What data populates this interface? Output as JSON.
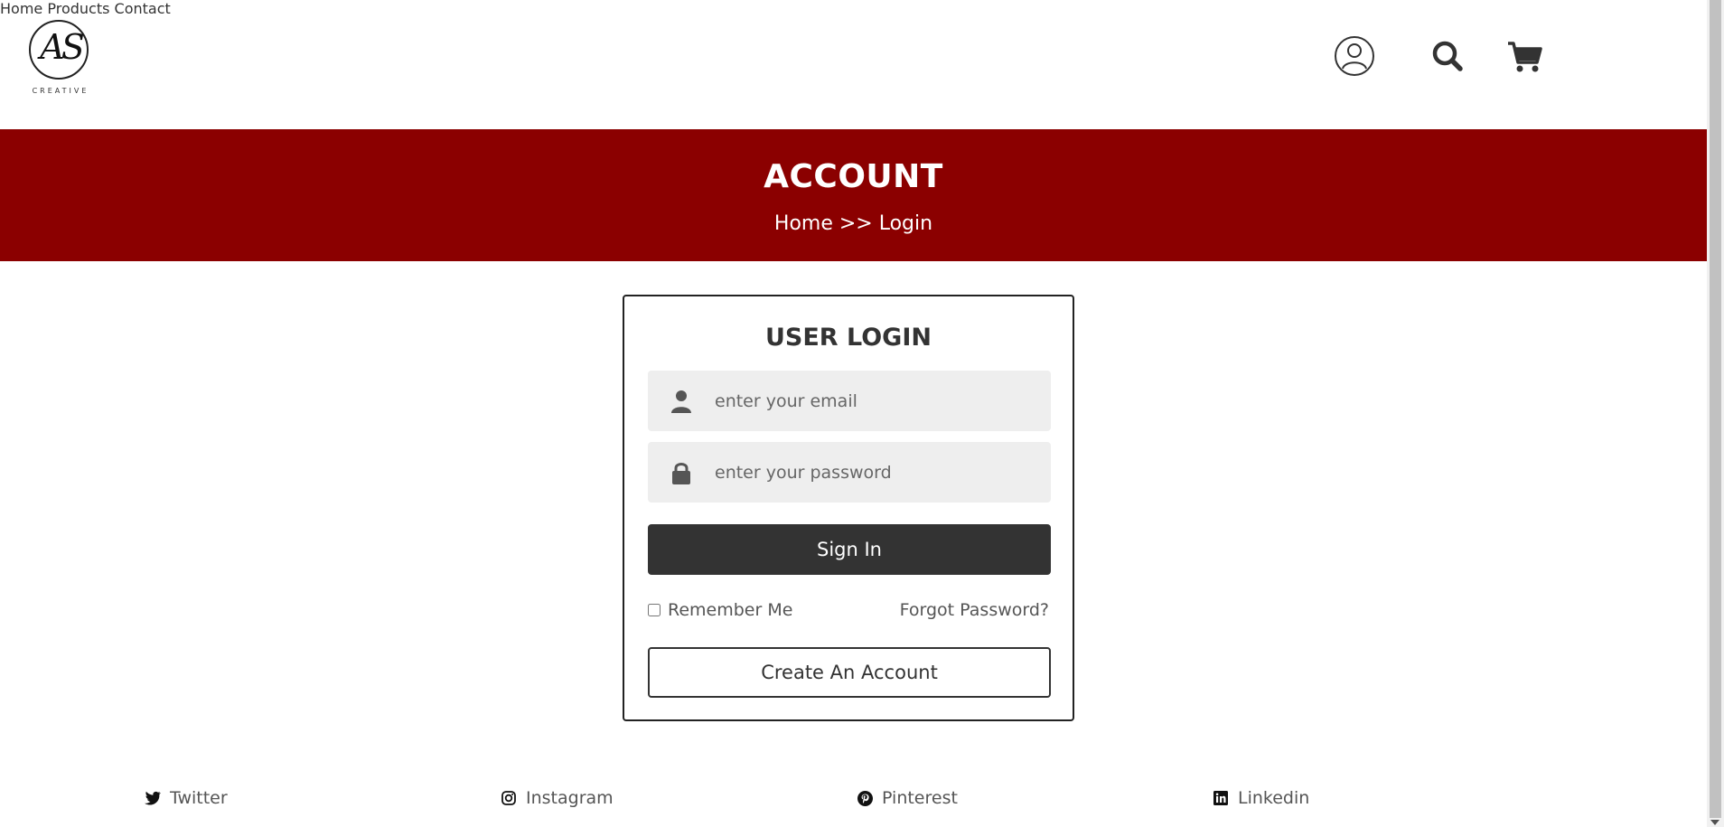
{
  "brand": {
    "monogram": "AS",
    "subtitle": "CREATIVE"
  },
  "nav": {
    "home": "Home",
    "products": "Products",
    "contact": "Contact"
  },
  "header_icons": [
    "user-icon",
    "search-icon",
    "cart-icon"
  ],
  "banner": {
    "title": "ACCOUNT",
    "breadcrumb": "Home >> Login"
  },
  "login": {
    "title": "USER LOGIN",
    "email_placeholder": "enter your email",
    "password_placeholder": "enter your password",
    "sign_in": "Sign In",
    "remember_me": "Remember Me",
    "forgot_password": "Forgot Password?",
    "create_account": "Create An Account"
  },
  "social": {
    "twitter": "Twitter",
    "instagram": "Instagram",
    "pinterest": "Pinterest",
    "linkedin": "Linkedin"
  },
  "colors": {
    "brand_red": "#8b0000",
    "dark_button": "#333333",
    "field_bg": "#eeeeee"
  }
}
